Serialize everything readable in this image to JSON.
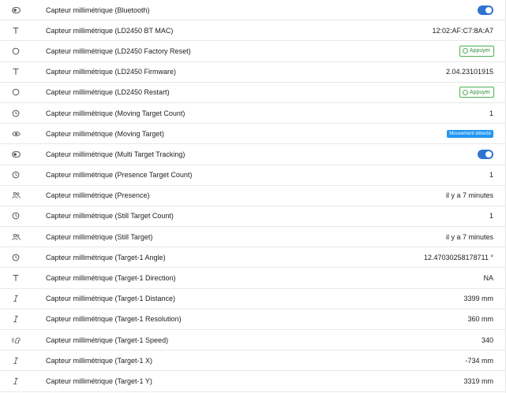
{
  "entities": [
    {
      "icon": "toggle-icon",
      "label": "Capteur millimétrique (Bluetooth)",
      "kind": "toggle",
      "on": true
    },
    {
      "icon": "text-icon",
      "label": "Capteur millimétrique (LD2450 BT MAC)",
      "kind": "text",
      "value": "12:02:AF:C7:8A:A7"
    },
    {
      "icon": "circle-button-icon",
      "label": "Capteur millimétrique (LD2450 Factory Reset)",
      "kind": "button",
      "value": "Appuyer"
    },
    {
      "icon": "text-icon",
      "label": "Capteur millimétrique (LD2450 Firmware)",
      "kind": "text",
      "value": "2.04.23101915"
    },
    {
      "icon": "circle-button-icon",
      "label": "Capteur millimétrique (LD2450 Restart)",
      "kind": "button",
      "value": "Appuyer"
    },
    {
      "icon": "gauge-icon",
      "label": "Capteur millimétrique (Moving Target Count)",
      "kind": "text",
      "value": "1"
    },
    {
      "icon": "eye-icon",
      "label": "Capteur millimétrique (Moving Target)",
      "kind": "badge",
      "value": "Mouvement détecté"
    },
    {
      "icon": "toggle-icon",
      "label": "Capteur millimétrique (Multi Target Tracking)",
      "kind": "toggle",
      "on": true
    },
    {
      "icon": "gauge-icon",
      "label": "Capteur millimétrique (Presence Target Count)",
      "kind": "text",
      "value": "1"
    },
    {
      "icon": "people-icon",
      "label": "Capteur millimétrique (Presence)",
      "kind": "text",
      "value": "il y a 7 minutes"
    },
    {
      "icon": "gauge-icon",
      "label": "Capteur millimétrique (Still Target Count)",
      "kind": "text",
      "value": "1"
    },
    {
      "icon": "people-icon",
      "label": "Capteur millimétrique (Still Target)",
      "kind": "text",
      "value": "il y a 7 minutes"
    },
    {
      "icon": "gauge-icon",
      "label": "Capteur millimétrique (Target-1 Angle)",
      "kind": "text",
      "value": "12.47030258178711 °"
    },
    {
      "icon": "text-icon",
      "label": "Capteur millimétrique (Target-1 Direction)",
      "kind": "text",
      "value": "NA"
    },
    {
      "icon": "italic-i-icon",
      "label": "Capteur millimétrique (Target-1 Distance)",
      "kind": "text",
      "value": "3399 mm"
    },
    {
      "icon": "italic-i-icon",
      "label": "Capteur millimétrique (Target-1 Resolution)",
      "kind": "text",
      "value": "360 mm"
    },
    {
      "icon": "speed-icon",
      "label": "Capteur millimétrique (Target-1 Speed)",
      "kind": "text",
      "value": "340"
    },
    {
      "icon": "italic-i-icon",
      "label": "Capteur millimétrique (Target-1 X)",
      "kind": "text",
      "value": "-734 mm"
    },
    {
      "icon": "italic-i-icon",
      "label": "Capteur millimétrique (Target-1 Y)",
      "kind": "text",
      "value": "3319 mm"
    }
  ],
  "colors": {
    "toggle_on": "#2f74d0",
    "button_green": "#4caf50",
    "badge_blue": "#2196f3",
    "divider": "#e8e8e8"
  }
}
